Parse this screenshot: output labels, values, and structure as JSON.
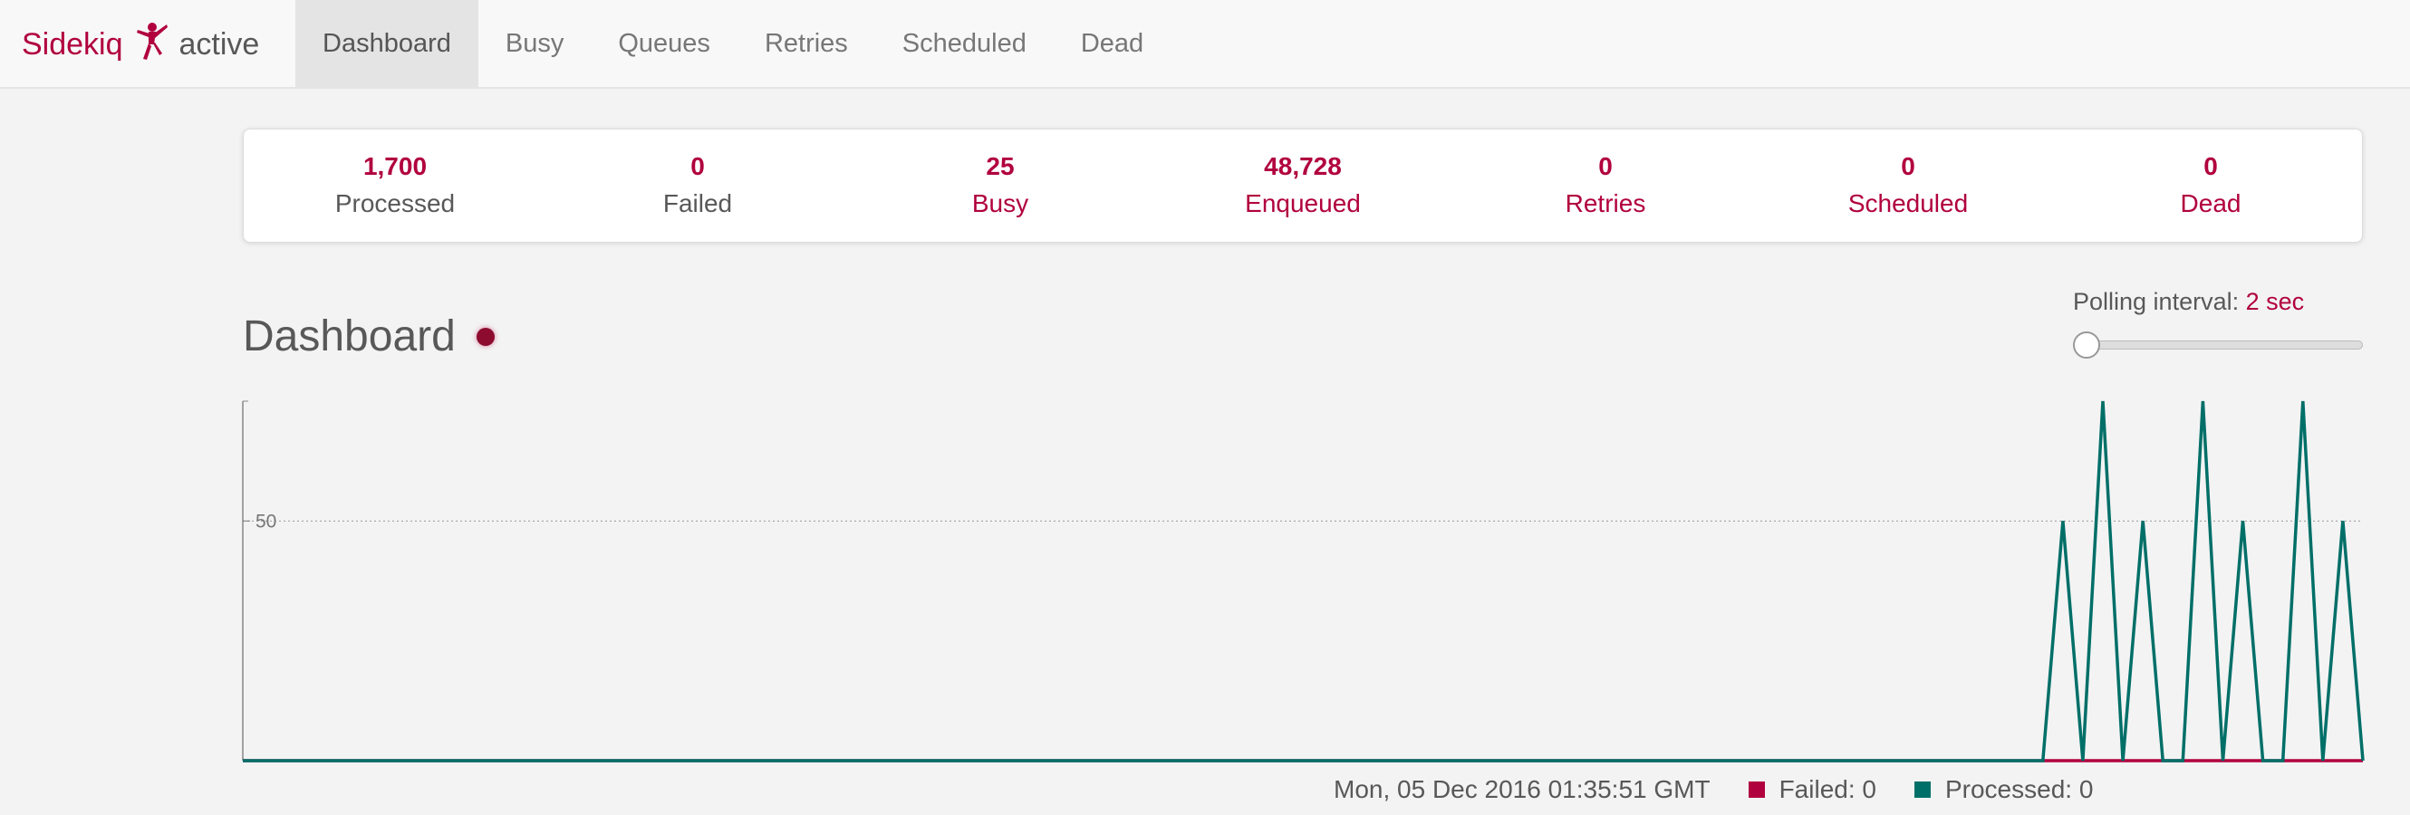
{
  "brand": {
    "name": "Sidekiq",
    "status": "active",
    "logo_icon": "ninja-logo-icon"
  },
  "nav": {
    "items": [
      {
        "label": "Dashboard",
        "active": true
      },
      {
        "label": "Busy",
        "active": false
      },
      {
        "label": "Queues",
        "active": false
      },
      {
        "label": "Retries",
        "active": false
      },
      {
        "label": "Scheduled",
        "active": false
      },
      {
        "label": "Dead",
        "active": false
      }
    ]
  },
  "summary": {
    "processed": {
      "count": "1,700",
      "label": "Processed"
    },
    "failed": {
      "count": "0",
      "label": "Failed"
    },
    "busy": {
      "count": "25",
      "label": "Busy"
    },
    "enqueued": {
      "count": "48,728",
      "label": "Enqueued"
    },
    "retries": {
      "count": "0",
      "label": "Retries"
    },
    "scheduled": {
      "count": "0",
      "label": "Scheduled"
    },
    "dead": {
      "count": "0",
      "label": "Dead"
    }
  },
  "dashboard": {
    "title": "Dashboard",
    "polling_label": "Polling interval:",
    "polling_value": "2 sec",
    "polling_slider_fraction": 0
  },
  "colors": {
    "accent": "#b1003e",
    "failed": "#b1003e",
    "processed": "#006f68",
    "beacon": "#8d0b2e"
  },
  "chart_data": {
    "type": "line",
    "ylim": [
      0,
      75
    ],
    "y_ticks": [
      50
    ],
    "y_tick_labels": [
      "50"
    ],
    "grid": true,
    "legend_placement": "bottom-right",
    "series": [
      {
        "name": "Failed",
        "color": "#b1003e",
        "values": [
          0,
          0,
          0,
          0,
          0,
          0,
          0,
          0,
          0,
          0,
          0,
          0,
          0,
          0,
          0,
          0,
          0,
          0,
          0,
          0,
          0,
          0,
          0,
          0,
          0,
          0,
          0,
          0,
          0,
          0,
          0,
          0,
          0,
          0,
          0,
          0,
          0,
          0,
          0,
          0,
          0,
          0,
          0,
          0,
          0,
          0,
          0,
          0,
          0,
          0,
          0,
          0,
          0,
          0,
          0,
          0,
          0,
          0,
          0,
          0,
          0,
          0,
          0,
          0,
          0,
          0,
          0,
          0,
          0,
          0,
          0,
          0,
          0,
          0,
          0,
          0,
          0,
          0,
          0,
          0,
          0,
          0,
          0,
          0,
          0,
          0,
          0,
          0,
          0,
          0,
          0,
          0,
          0,
          0,
          0,
          0,
          0,
          0,
          0,
          0
        ]
      },
      {
        "name": "Processed",
        "color": "#006f68",
        "values": [
          0,
          0,
          0,
          0,
          0,
          0,
          0,
          0,
          0,
          0,
          0,
          0,
          0,
          0,
          0,
          0,
          0,
          0,
          0,
          0,
          0,
          0,
          0,
          0,
          0,
          0,
          0,
          0,
          0,
          0,
          0,
          0,
          0,
          0,
          0,
          0,
          0,
          0,
          0,
          0,
          0,
          0,
          0,
          0,
          0,
          0,
          0,
          0,
          0,
          0,
          0,
          0,
          0,
          0,
          0,
          0,
          0,
          0,
          0,
          0,
          0,
          0,
          0,
          0,
          0,
          0,
          0,
          0,
          0,
          0,
          0,
          0,
          0,
          0,
          0,
          0,
          0,
          0,
          0,
          0,
          0,
          0,
          0,
          0,
          0,
          0,
          0,
          0,
          0,
          0,
          0,
          50,
          0,
          75,
          0,
          50,
          0,
          0,
          75,
          0,
          50,
          0,
          0,
          75,
          0,
          50,
          0
        ]
      }
    ]
  },
  "legend": {
    "timestamp": "Mon, 05 Dec 2016 01:35:51 GMT",
    "failed_text": "Failed: 0",
    "processed_text": "Processed: 0"
  }
}
